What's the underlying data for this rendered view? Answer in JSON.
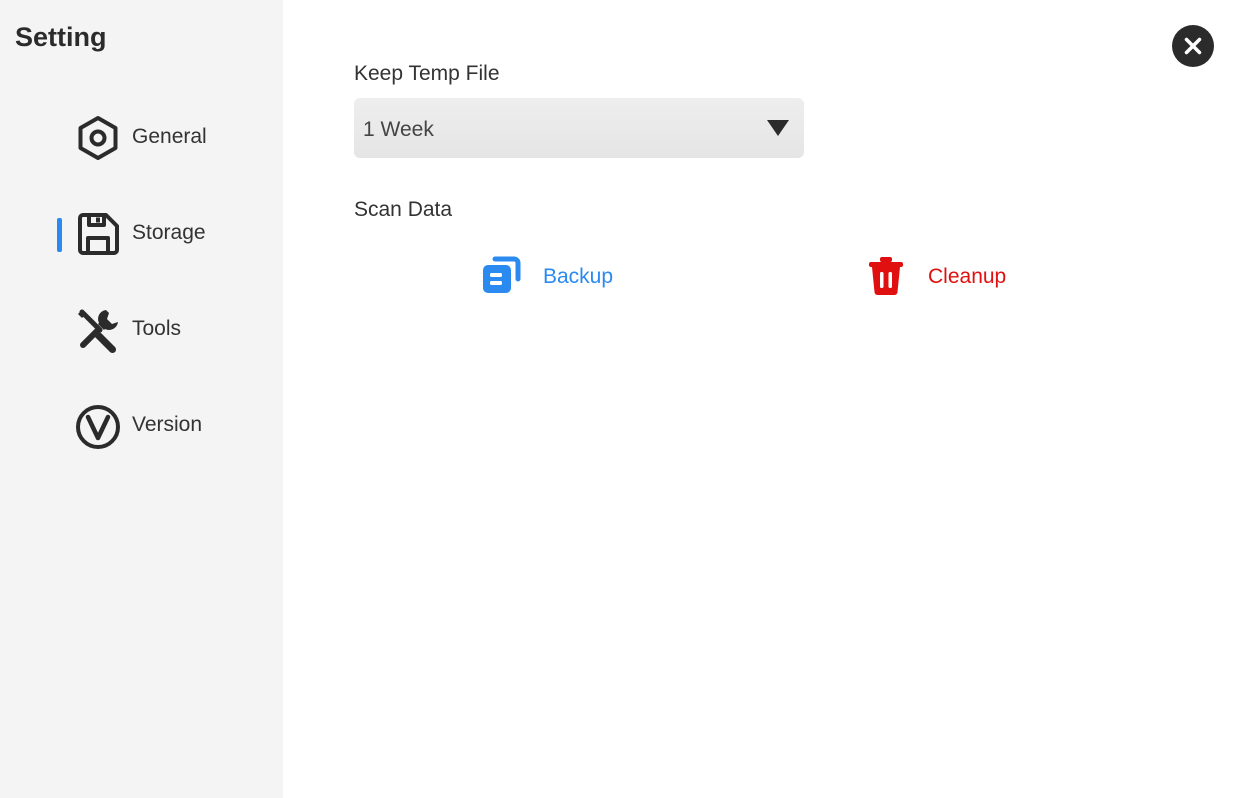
{
  "sidebar": {
    "title": "Setting",
    "items": [
      {
        "label": "General",
        "icon": "hexagon-nut-icon",
        "active": false
      },
      {
        "label": "Storage",
        "icon": "floppy-disk-icon",
        "active": true
      },
      {
        "label": "Tools",
        "icon": "wrench-screwdriver-icon",
        "active": false
      },
      {
        "label": "Version",
        "icon": "version-circle-icon",
        "active": false
      }
    ]
  },
  "main": {
    "keep_temp_label": "Keep Temp File",
    "keep_temp_value": "1 Week",
    "scan_data_label": "Scan Data",
    "backup_label": "Backup",
    "cleanup_label": "Cleanup"
  },
  "colors": {
    "accent": "#2a8af0",
    "danger": "#e01010",
    "sidebar_bg": "#f4f4f4",
    "icon_dark": "#2b2b2b"
  }
}
